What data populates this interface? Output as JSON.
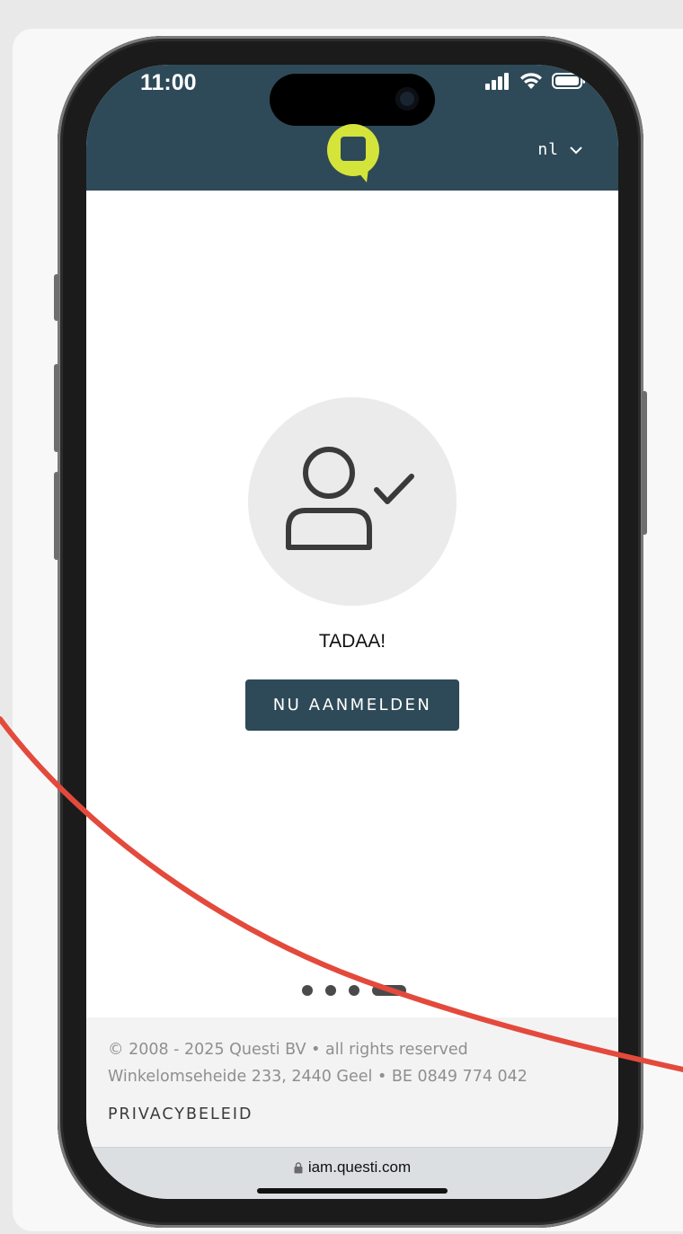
{
  "status_bar": {
    "time": "11:00"
  },
  "header": {
    "logo_name": "questi-logo-icon",
    "language": {
      "selected": "nl"
    },
    "colors": {
      "background": "#2e4a58",
      "logo": "#d4e43a"
    }
  },
  "main": {
    "icon": "user-check-icon",
    "title": "TADAA!",
    "button_label": "NU AANMELDEN",
    "pagination": {
      "total": 4,
      "active_index": 3
    }
  },
  "footer": {
    "copyright": "© 2008 - 2025 Questi BV • all rights reserved",
    "address": "Winkelomseheide 233, 2440 Geel • BE 0849 774 042",
    "privacy_link": "PRIVACYBELEID"
  },
  "browser": {
    "url": "iam.questi.com"
  },
  "annotation": {
    "color": "#e34a3c"
  }
}
